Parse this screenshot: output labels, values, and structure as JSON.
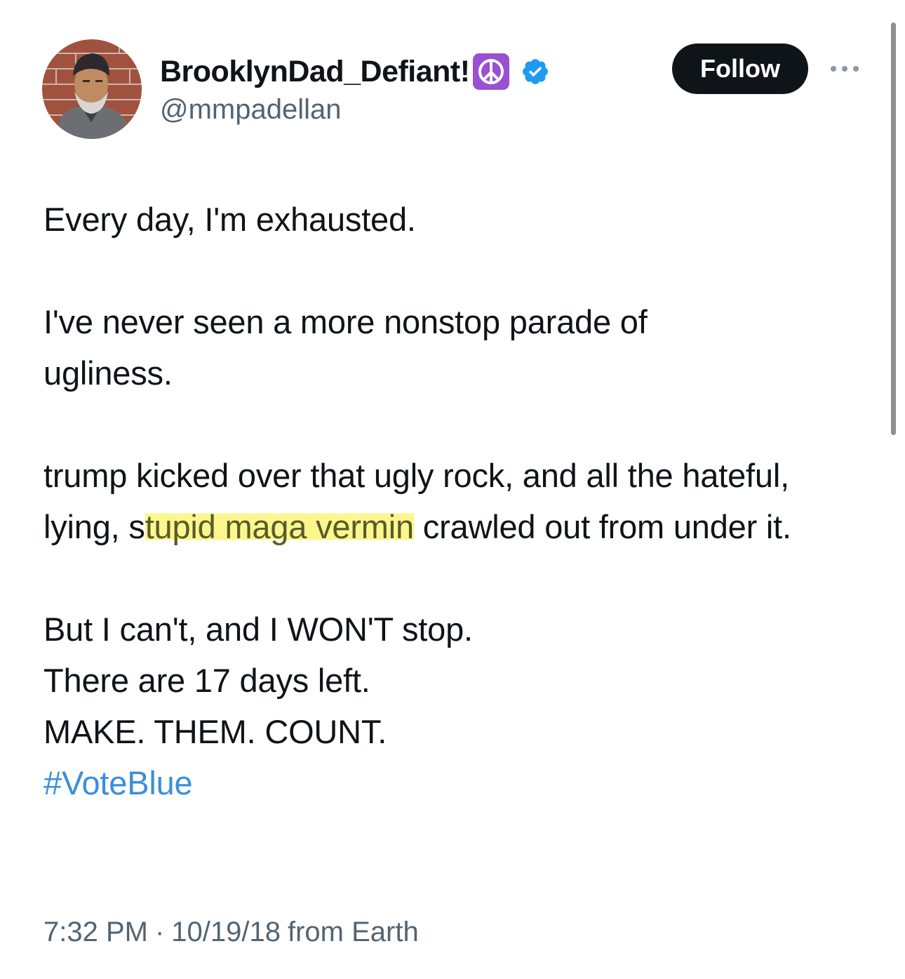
{
  "user": {
    "display_name": "BrooklynDad_Defiant!",
    "name_emoji": "peace-symbol",
    "verified": true,
    "handle": "@mmpadellan"
  },
  "actions": {
    "follow_label": "Follow"
  },
  "tweet": {
    "line1": "Every day, I'm exhausted.",
    "line2": "I've never seen a more nonstop parade of ugliness.",
    "line3_before": "trump kicked over that ugly rock, and all the hateful, lying, s",
    "line3_highlight": "tupid maga vermin",
    "line3_after": " crawled out from under it.",
    "line4": "But I can't, and I WON'T stop.",
    "line5": "There are 17 days left.",
    "line6": "MAKE. THEM. COUNT.",
    "hashtag": "#VoteBlue"
  },
  "meta": {
    "time": "7:32 PM",
    "separator": "·",
    "date": "10/19/18",
    "source": "from Earth"
  },
  "colors": {
    "follow_bg": "#0f1419",
    "verified": "#1d9bf0",
    "hashtag": "#3a8fd9",
    "highlight": "#fbf78e",
    "secondary_text": "#536471"
  }
}
